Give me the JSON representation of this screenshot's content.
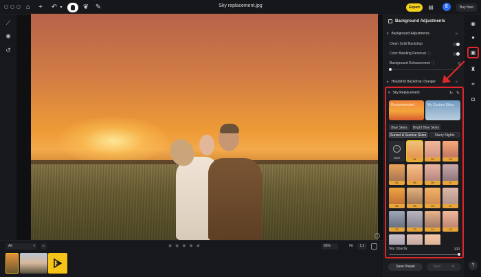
{
  "app": {
    "doc_title": "Sky replacement.jpg",
    "export_label": "Export",
    "avatar_initial": "E",
    "buy_now_label": "Buy Now"
  },
  "panel": {
    "title": "Background Adjustments",
    "bg_adjustments": {
      "header": "Background Adjustments",
      "rows": [
        {
          "label": "Clean Solid Backdrop",
          "help": "ⓘ"
        },
        {
          "label": "Color Banding Removal",
          "help": "ⓘ"
        }
      ],
      "enhancement_label": "Background Enhancement",
      "enhancement_help": "ⓘ",
      "enhancement_value": "0"
    },
    "headshot_header": "Headshot Backdrop Changer",
    "sky": {
      "header": "Sky Replacement",
      "cards": [
        "Recommended",
        "My Custom Skies"
      ],
      "chips": [
        "Blue Skies",
        "Bright Blue Skies",
        "Sunset & Sunrise Skies",
        "Starry Nights"
      ],
      "selected_chip": "Sunset & Sunrise Skies",
      "none_label": "None",
      "tile_badges": [
        "01",
        "02",
        "03",
        "04",
        "05",
        "06",
        "07",
        "08",
        "09",
        "10",
        "11",
        "12",
        "13",
        "14",
        "15",
        "16",
        "17",
        "18"
      ],
      "opacity_label": "Sky Opacity",
      "opacity_value": "100",
      "opacity_level": 1.0
    },
    "save_preset_label": "Save Preset",
    "sync_label": "Sync"
  },
  "bottom": {
    "filter_value": "All",
    "zoom_value": "66%",
    "fit_label": "Fit",
    "one_label": "1:1",
    "rating": 0,
    "rating_max": 5
  },
  "colors": {
    "accent_yellow": "#f5d21b",
    "highlight_red": "#e0262a",
    "badge_orange": "#e8a53a"
  }
}
